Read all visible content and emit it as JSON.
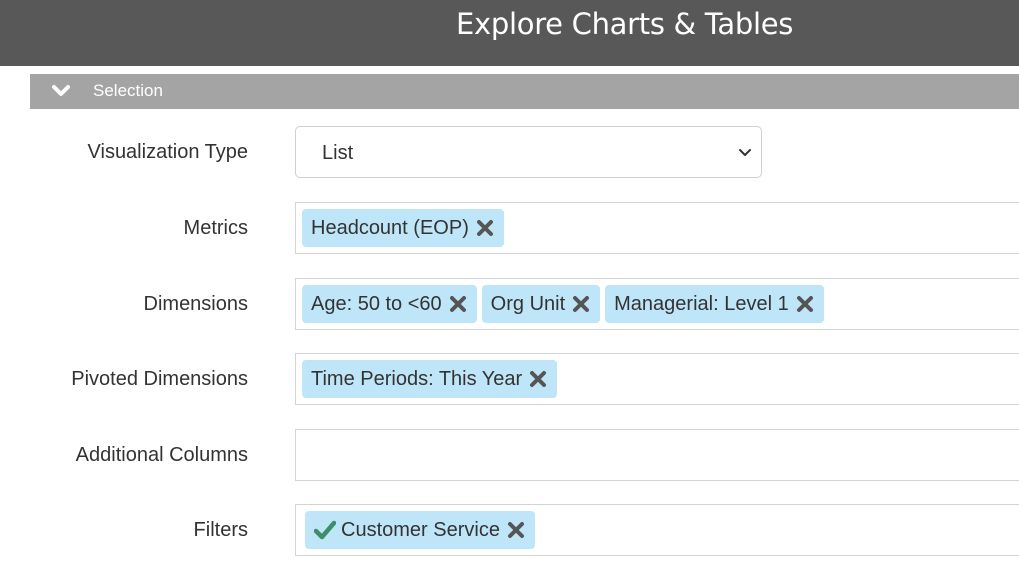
{
  "header": {
    "title": "Explore Charts & Tables"
  },
  "section": {
    "label": "Selection",
    "icon": "chevron-down-icon"
  },
  "form": {
    "visualization_type": {
      "label": "Visualization Type",
      "value": "List"
    },
    "metrics": {
      "label": "Metrics",
      "tags": [
        "Headcount (EOP)"
      ]
    },
    "dimensions": {
      "label": "Dimensions",
      "tags": [
        "Age: 50 to <60",
        "Org Unit",
        "Managerial: Level 1"
      ]
    },
    "pivoted_dimensions": {
      "label": "Pivoted Dimensions",
      "tags": [
        "Time Periods: This Year"
      ]
    },
    "additional_columns": {
      "label": "Additional Columns",
      "tags": []
    },
    "filters": {
      "label": "Filters",
      "tags": [
        "Customer Service"
      ]
    }
  },
  "colors": {
    "header_bg": "#585858",
    "section_bg": "#a4a4a4",
    "tag_bg": "#bfe6f8",
    "check_green": "#3d8f6a"
  }
}
